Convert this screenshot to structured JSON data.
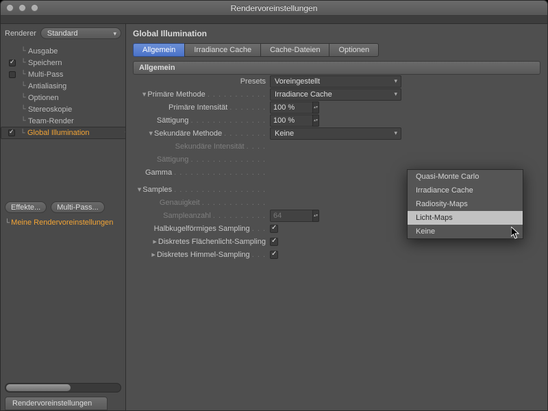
{
  "window": {
    "title": "Rendervoreinstellungen"
  },
  "sidebar": {
    "renderer_label": "Renderer",
    "renderer_value": "Standard",
    "items": [
      {
        "label": "Ausgabe",
        "cb": null
      },
      {
        "label": "Speichern",
        "cb": true
      },
      {
        "label": "Multi-Pass",
        "cb": false
      },
      {
        "label": "Antialiasing",
        "cb": null
      },
      {
        "label": "Optionen",
        "cb": null
      },
      {
        "label": "Stereoskopie",
        "cb": null
      },
      {
        "label": "Team-Render",
        "cb": null
      },
      {
        "label": "Global Illumination",
        "cb": true,
        "sel": true
      }
    ],
    "btn_effects": "Effekte...",
    "btn_multipass": "Multi-Pass...",
    "mini_prefix": "└",
    "mini_text": "Meine Rendervoreinstellungen",
    "tab_label": "Rendervoreinstellungen"
  },
  "panel": {
    "title": "Global Illumination",
    "tabs": [
      "Allgemein",
      "Irradiance Cache",
      "Cache-Dateien",
      "Optionen"
    ],
    "section": "Allgemein",
    "presets_label": "Presets",
    "presets_value": "Voreingestellt",
    "primary_method_label": "Primäre Methode",
    "primary_method_value": "Irradiance Cache",
    "primary_intensity_label": "Primäre Intensität",
    "primary_intensity_value": "100 %",
    "primary_sat_label": "Sättigung",
    "primary_sat_value": "100 %",
    "secondary_method_label": "Sekundäre Methode",
    "secondary_method_value": "Keine",
    "secondary_intensity_label": "Sekundäre Intensität",
    "secondary_sat_label": "Sättigung",
    "gamma_label": "Gamma",
    "samples_label": "Samples",
    "accuracy_label": "Genauigkeit",
    "samplecount_label": "Sampleanzahl",
    "samplecount_value": "64",
    "hemi_label": "Halbkugelförmiges Sampling",
    "disc_area_label": "Diskretes Flächenlicht-Sampling",
    "disc_sky_label": "Diskretes Himmel-Sampling"
  },
  "popup": {
    "options": [
      "Quasi-Monte Carlo",
      "Irradiance Cache",
      "Radiosity-Maps",
      "Licht-Maps",
      "Keine"
    ],
    "highlight_index": 3
  }
}
